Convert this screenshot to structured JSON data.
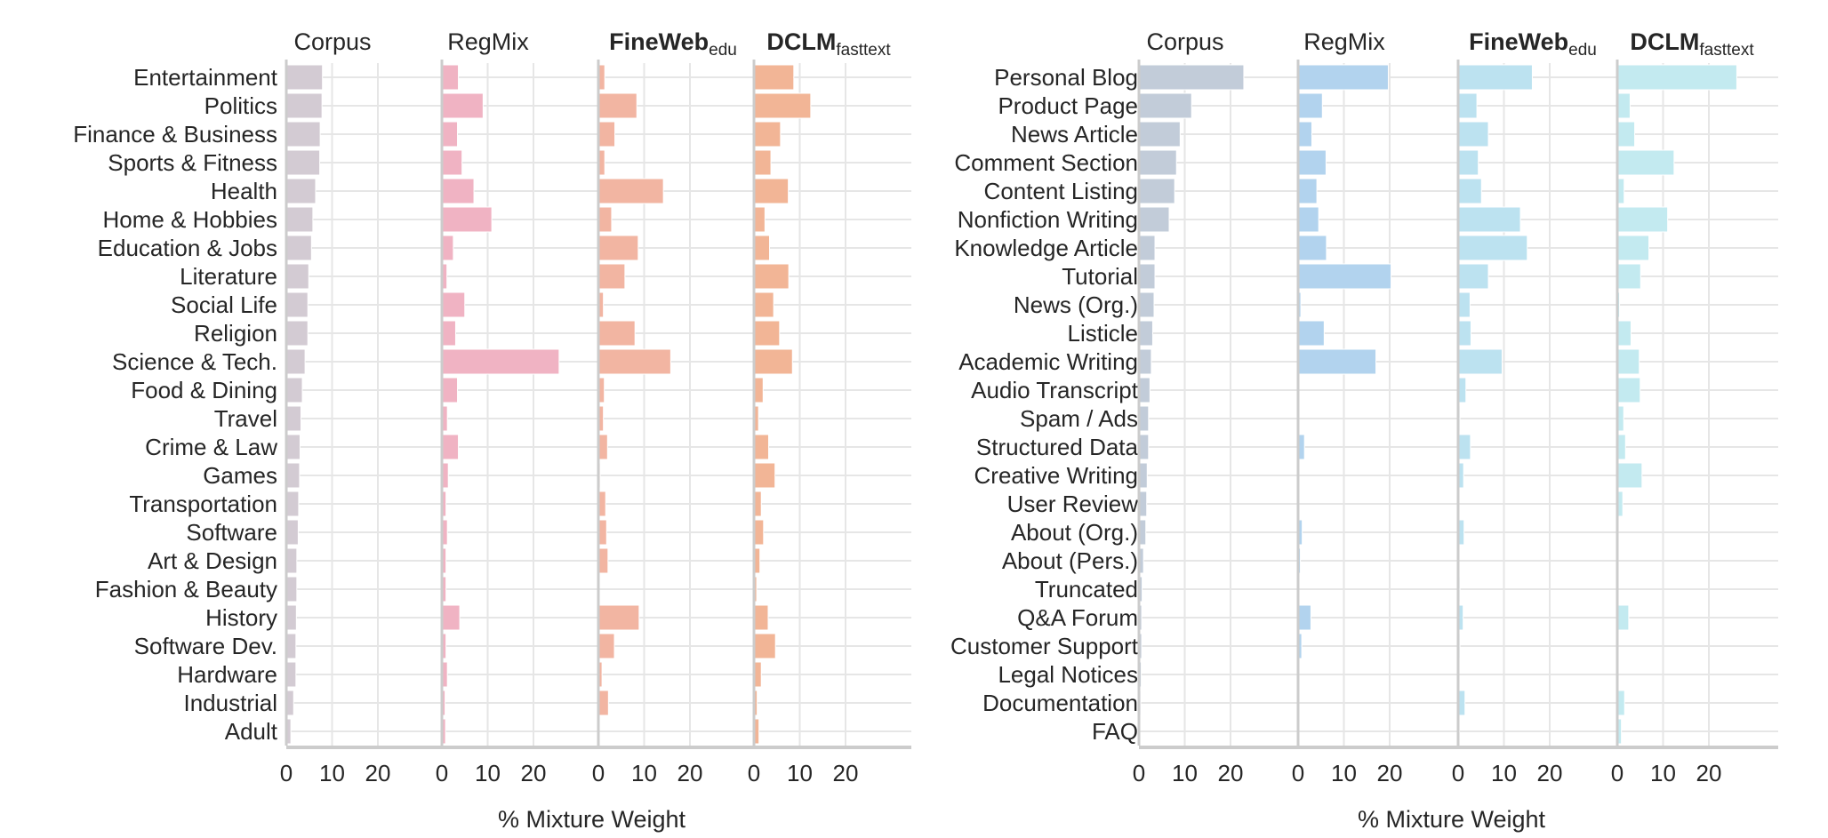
{
  "chart_data": [
    {
      "type": "bar",
      "orientation": "horizontal",
      "group": "topic",
      "xlabel": "% Mixture Weight",
      "xticks": [
        0,
        10,
        20
      ],
      "xlim": [
        0,
        34
      ],
      "grid": true,
      "categories": [
        "Entertainment",
        "Politics",
        "Finance & Business",
        "Sports & Fitness",
        "Health",
        "Home & Hobbies",
        "Education & Jobs",
        "Literature",
        "Social Life",
        "Religion",
        "Science & Tech.",
        "Food & Dining",
        "Travel",
        "Crime & Law",
        "Games",
        "Transportation",
        "Software",
        "Art & Design",
        "Fashion & Beauty",
        "History",
        "Software Dev.",
        "Hardware",
        "Industrial",
        "Adult"
      ],
      "series": [
        {
          "name": "Corpus",
          "name_main": "Corpus",
          "name_sub": "",
          "bold": false,
          "color": "#d3cbd3",
          "values": [
            7.9,
            7.8,
            7.4,
            7.3,
            6.4,
            5.8,
            5.5,
            4.9,
            4.7,
            4.7,
            4.1,
            3.5,
            3.2,
            3.0,
            2.9,
            2.7,
            2.6,
            2.3,
            2.3,
            2.2,
            2.1,
            2.1,
            1.6,
            1.0
          ]
        },
        {
          "name": "RegMix",
          "name_main": "RegMix",
          "name_sub": "",
          "bold": false,
          "color": "#f0b3c3",
          "values": [
            3.6,
            9.0,
            3.4,
            4.4,
            7.0,
            10.9,
            2.5,
            1.1,
            5.0,
            3.0,
            25.6,
            3.4,
            1.2,
            3.6,
            1.4,
            0.9,
            1.2,
            0.9,
            0.9,
            3.9,
            0.9,
            1.2,
            0.7,
            0.8
          ]
        },
        {
          "name": "FineWeb-edu",
          "name_main": "FineWeb",
          "name_sub": "edu",
          "bold": true,
          "color": "#f2b5a2",
          "values": [
            1.4,
            8.4,
            3.6,
            1.4,
            14.2,
            2.9,
            8.7,
            5.8,
            1.1,
            8.0,
            15.8,
            1.3,
            1.1,
            2.0,
            0.4,
            1.6,
            1.8,
            2.1,
            0.1,
            8.9,
            3.5,
            0.8,
            2.2,
            0.0
          ]
        },
        {
          "name": "DCLM-fasttext",
          "name_main": "DCLM",
          "name_sub": "fasttext",
          "bold": true,
          "color": "#f2b596",
          "values": [
            8.7,
            12.4,
            5.8,
            3.7,
            7.5,
            2.4,
            3.4,
            7.6,
            4.3,
            5.6,
            8.4,
            2.0,
            1.0,
            3.2,
            4.6,
            1.6,
            2.1,
            1.3,
            0.6,
            3.1,
            4.7,
            1.6,
            0.7,
            1.1
          ]
        }
      ]
    },
    {
      "type": "bar",
      "orientation": "horizontal",
      "group": "format",
      "xlabel": "% Mixture Weight",
      "xticks": [
        0,
        10,
        20
      ],
      "xlim": [
        0,
        34
      ],
      "grid": true,
      "categories": [
        "Personal Blog",
        "Product Page",
        "News Article",
        "Comment Section",
        "Content Listing",
        "Nonfiction Writing",
        "Knowledge Article",
        "Tutorial",
        "News (Org.)",
        "Listicle",
        "Academic Writing",
        "Audio Transcript",
        "Spam / Ads",
        "Structured Data",
        "Creative Writing",
        "User Review",
        "About (Org.)",
        "About (Pers.)",
        "Truncated",
        "Q&A Forum",
        "Customer Support",
        "Legal Notices",
        "Documentation",
        "FAQ"
      ],
      "series": [
        {
          "name": "Corpus",
          "name_main": "Corpus",
          "name_sub": "",
          "bold": false,
          "color": "#c2ccd9",
          "values": [
            22.9,
            11.5,
            9.0,
            8.2,
            7.8,
            6.6,
            3.5,
            3.5,
            3.3,
            3.0,
            2.7,
            2.4,
            2.1,
            2.1,
            1.8,
            1.7,
            1.5,
            1.0,
            0.7,
            0.6,
            0.6,
            0.5,
            0.4,
            0.2
          ]
        },
        {
          "name": "RegMix",
          "name_main": "RegMix",
          "name_sub": "",
          "bold": false,
          "color": "#b2d3ee",
          "values": [
            19.7,
            5.3,
            3.0,
            6.1,
            4.1,
            4.5,
            6.2,
            20.3,
            0.6,
            5.7,
            17.0,
            0.0,
            0.0,
            1.4,
            0.1,
            0.0,
            0.9,
            0.5,
            0.0,
            2.8,
            0.8,
            0.0,
            0.0,
            0.0
          ]
        },
        {
          "name": "FineWeb-edu",
          "name_main": "FineWeb",
          "name_sub": "edu",
          "bold": true,
          "color": "#bce2f0",
          "values": [
            16.2,
            4.1,
            6.6,
            4.4,
            5.1,
            13.6,
            15.1,
            6.6,
            2.6,
            2.8,
            9.6,
            1.7,
            0.4,
            2.7,
            1.2,
            0.1,
            1.3,
            0.1,
            0.4,
            1.1,
            0.4,
            0.0,
            1.5,
            0.3
          ]
        },
        {
          "name": "DCLM-fasttext",
          "name_main": "DCLM",
          "name_sub": "fasttext",
          "bold": true,
          "color": "#c3eaf0",
          "values": [
            26.1,
            2.8,
            3.8,
            12.4,
            1.5,
            11.0,
            6.9,
            5.1,
            0.5,
            3.0,
            4.8,
            5.0,
            1.4,
            1.8,
            5.4,
            1.2,
            0.2,
            0.2,
            0.1,
            2.5,
            0.1,
            0.0,
            1.6,
            0.9
          ]
        }
      ]
    }
  ]
}
